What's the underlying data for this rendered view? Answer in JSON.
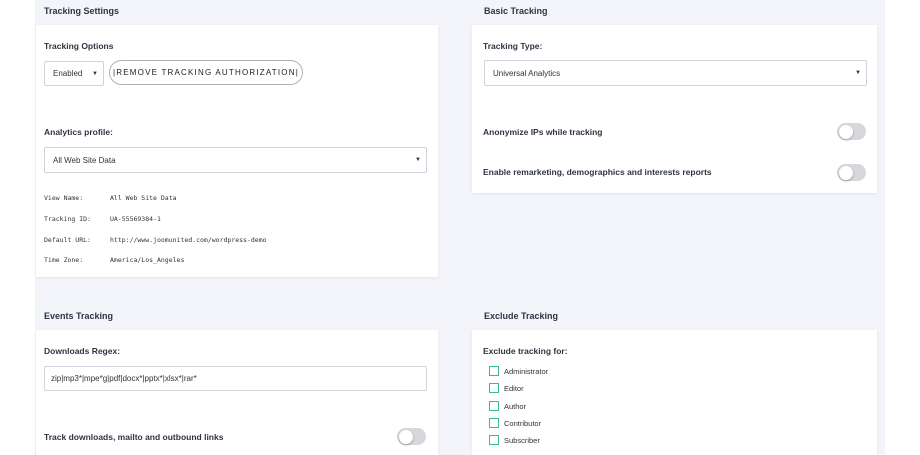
{
  "tracking_settings": {
    "title": "Tracking Settings",
    "options_label": "Tracking Options",
    "status_select": "Enabled",
    "remove_button": "|REMOVE TRACKING AUTHORIZATION|",
    "profile_label": "Analytics profile:",
    "profile_select": "All Web Site Data",
    "details": [
      {
        "key": "View Name:",
        "value": "All Web Site Data"
      },
      {
        "key": "Tracking ID:",
        "value": "UA-55569384-1"
      },
      {
        "key": "Default URL:",
        "value": "http://www.joomunited.com/wordpress-demo"
      },
      {
        "key": "Time Zone:",
        "value": "America/Los_Angeles"
      }
    ]
  },
  "basic_tracking": {
    "title": "Basic Tracking",
    "type_label": "Tracking Type:",
    "type_select": "Universal Analytics",
    "anonymize_label": "Anonymize IPs while tracking",
    "anonymize_on": false,
    "remarketing_label": "Enable remarketing, demographics and interests reports",
    "remarketing_on": false
  },
  "events_tracking": {
    "title": "Events Tracking",
    "regex_label": "Downloads Regex:",
    "regex_value": "zip|mp3*|mpe*g|pdf|docx*|pptx*|xlsx*|rar*",
    "track_links_label": "Track downloads, mailto and outbound links",
    "track_links_on": false
  },
  "exclude_tracking": {
    "title": "Exclude Tracking",
    "for_label": "Exclude tracking for:",
    "roles": [
      "Administrator",
      "Editor",
      "Author",
      "Contributor",
      "Subscriber"
    ]
  },
  "colors": {
    "checkbox_border": "#3dbb8a",
    "toggle_off": "#d6d8dc",
    "background": "#f3f5fa"
  }
}
